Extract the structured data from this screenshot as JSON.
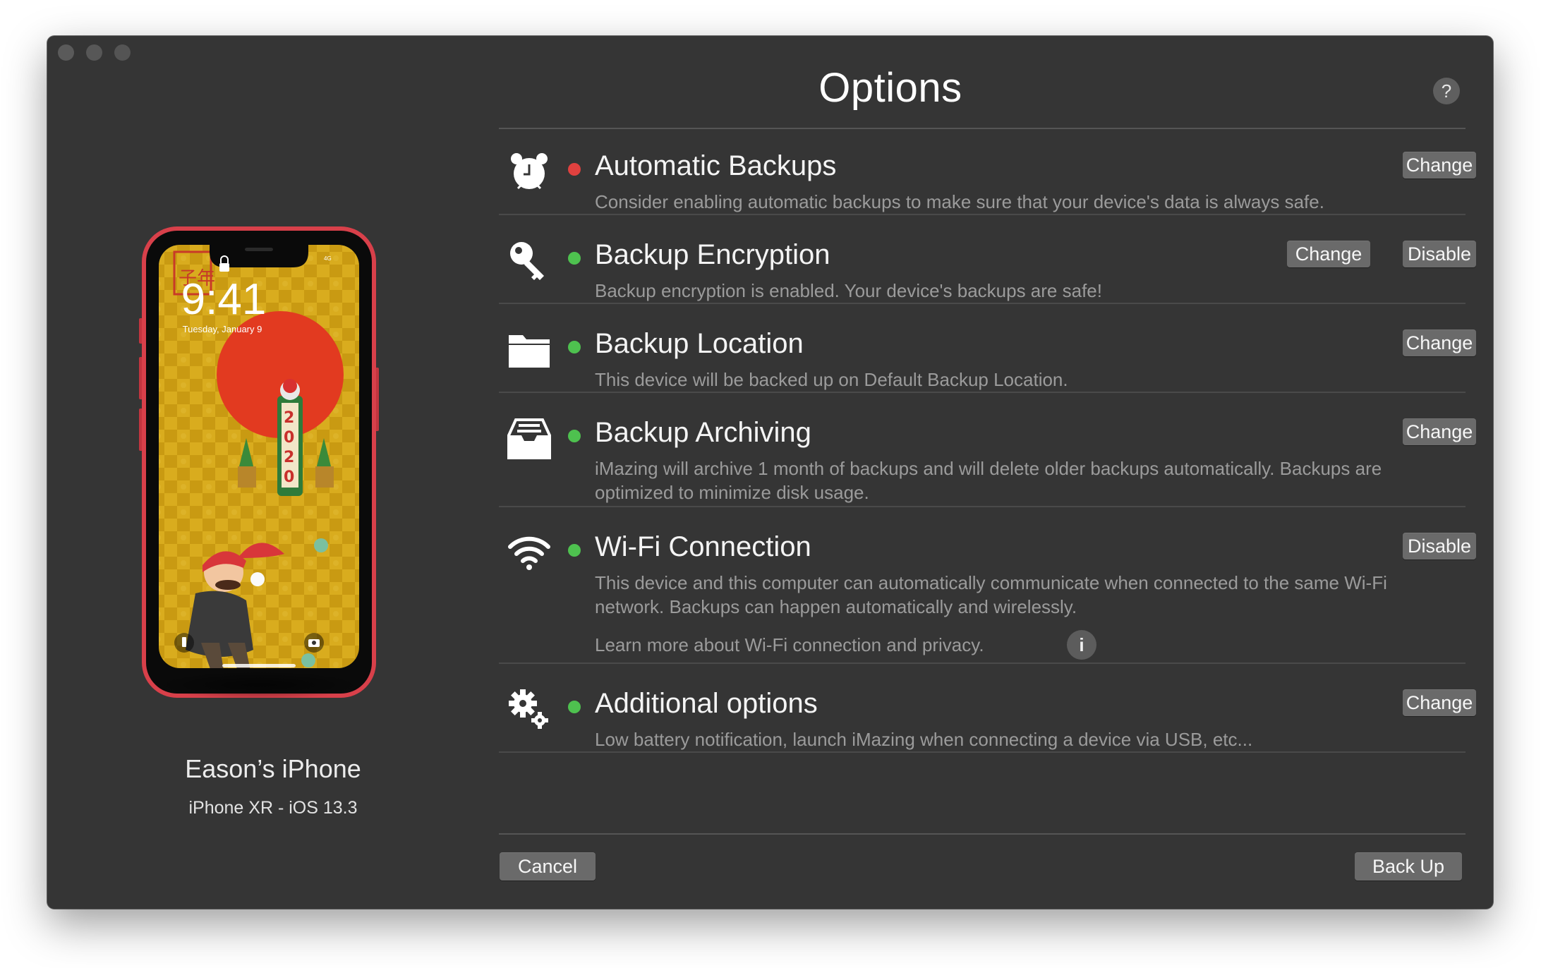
{
  "window": {
    "traffic_lights": [
      "close",
      "minimize",
      "zoom"
    ]
  },
  "device": {
    "name": "Eason’s iPhone",
    "model": "iPhone XR - iOS 13.3",
    "lockscreen": {
      "time": "9:41",
      "date": "Tuesday, January 9",
      "carrier": "4G"
    },
    "frame_color": "#d8404a"
  },
  "header": {
    "title": "Options",
    "help_label": "?"
  },
  "options": [
    {
      "icon": "alarm-clock-icon",
      "status": "red",
      "title": "Automatic Backups",
      "description": "Consider enabling automatic backups to make sure that your device's data is always safe.",
      "buttons": [
        "Change"
      ]
    },
    {
      "icon": "key-icon",
      "status": "green",
      "title": "Backup Encryption",
      "description": "Backup encryption is enabled. Your device's backups are safe!",
      "buttons": [
        "Change",
        "Disable"
      ]
    },
    {
      "icon": "folder-icon",
      "status": "green",
      "title": "Backup Location",
      "description": "This device will be backed up on Default Backup Location.",
      "buttons": [
        "Change"
      ]
    },
    {
      "icon": "archive-tray-icon",
      "status": "green",
      "title": "Backup Archiving",
      "description": "iMazing will archive 1 month of backups and will delete older backups automatically. Backups are optimized to minimize disk usage.",
      "buttons": [
        "Change"
      ]
    },
    {
      "icon": "wifi-icon",
      "status": "green",
      "title": "Wi-Fi Connection",
      "description": "This device and this computer can automatically communicate when connected to the same Wi-Fi network. Backups can happen automatically and wirelessly.",
      "learn_more": "Learn more about Wi-Fi connection and privacy.",
      "info_label": "i",
      "buttons": [
        "Disable"
      ]
    },
    {
      "icon": "gears-icon",
      "status": "green",
      "title": "Additional options",
      "description": "Low battery notification, launch iMazing when connecting a device via USB, etc...",
      "buttons": [
        "Change"
      ]
    }
  ],
  "footer": {
    "cancel_label": "Cancel",
    "backup_label": "Back Up"
  },
  "colors": {
    "window_bg": "#353535",
    "status_red": "#e0413f",
    "status_green": "#4ec14f",
    "button_bg": "#6a6a6a"
  }
}
